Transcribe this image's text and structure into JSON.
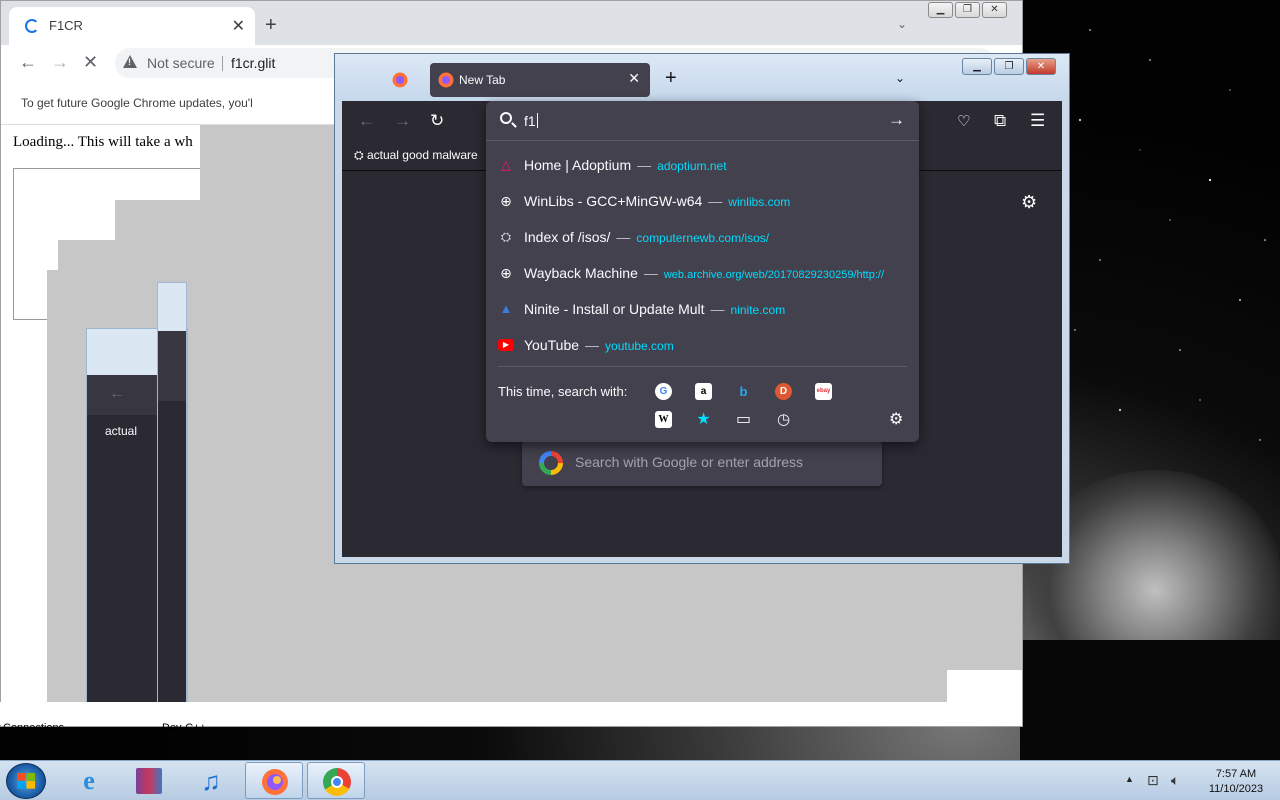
{
  "chrome": {
    "tab_title": "F1CR",
    "new_tab_symbol": "+",
    "address_warning": "Not secure",
    "address_url": "f1cr.glit",
    "infobar_text": "To get future Google Chrome updates, you'l",
    "page_text": "Loading... This will take a wh"
  },
  "ghost_windows": {
    "bookmark_label": "actual"
  },
  "below_windows": {
    "left_label": "Connections",
    "mid_label": "Dev-C++"
  },
  "firefox": {
    "tab_title": "New Tab",
    "bookmark": "actual good malware",
    "search_placeholder": "Search with Google or enter address",
    "urlbar": {
      "input": "f1",
      "results": [
        {
          "title": "Home | Adoptium",
          "url": "adoptium.net",
          "icon": "adoptium-icon",
          "color": "#ff1464"
        },
        {
          "title": "WinLibs - GCC+MinGW-w64",
          "url": "winlibs.com",
          "icon": "globe-icon",
          "color": "#fbfbfe"
        },
        {
          "title": "Index of /isos/",
          "url": "computernewb.com/isos/",
          "icon": "computernewb-icon",
          "color": "#cfcfd8"
        },
        {
          "title": "Wayback Machine",
          "url": "web.archive.org/web/20170829230259/http://",
          "icon": "globe-icon",
          "color": "#fbfbfe"
        },
        {
          "title": "Ninite - Install or Update Mult",
          "url": "ninite.com",
          "icon": "ninite-icon",
          "color": "#3d7be0"
        },
        {
          "title": "YouTube",
          "url": "youtube.com",
          "icon": "youtube-icon",
          "color": "#ff0000"
        }
      ],
      "dash": "—",
      "search_with_label": "This time, search with:",
      "engines": [
        {
          "name": "google-engine-icon",
          "glyph": "G",
          "bg": "#ffffff",
          "fg": "#4285f4"
        },
        {
          "name": "amazon-engine-icon",
          "glyph": "a",
          "bg": "#ffffff",
          "fg": "#000000"
        },
        {
          "name": "bing-engine-icon",
          "glyph": "b",
          "bg": "#42414d",
          "fg": "#2aa8f2"
        },
        {
          "name": "duckduckgo-engine-icon",
          "glyph": "D",
          "bg": "#de5833",
          "fg": "#ffffff"
        },
        {
          "name": "ebay-engine-icon",
          "glyph": "ebay",
          "bg": "#ffffff",
          "fg": "#e53238"
        },
        {
          "name": "wikipedia-engine-icon",
          "glyph": "W",
          "bg": "#ffffff",
          "fg": "#000000"
        },
        {
          "name": "bookmarks-engine-icon",
          "glyph": "★",
          "bg": "#42414d",
          "fg": "#00ddff"
        },
        {
          "name": "tabs-engine-icon",
          "glyph": "▭",
          "bg": "#42414d",
          "fg": "#fbfbfe"
        },
        {
          "name": "history-engine-icon",
          "glyph": "◷",
          "bg": "#42414d",
          "fg": "#fbfbfe"
        }
      ]
    }
  },
  "taskbar": {
    "time": "7:57 AM",
    "date": "11/10/2023",
    "items": [
      "internet-explorer-icon",
      "winrar-icon",
      "itunes-icon",
      "firefox-icon",
      "chrome-icon"
    ]
  }
}
